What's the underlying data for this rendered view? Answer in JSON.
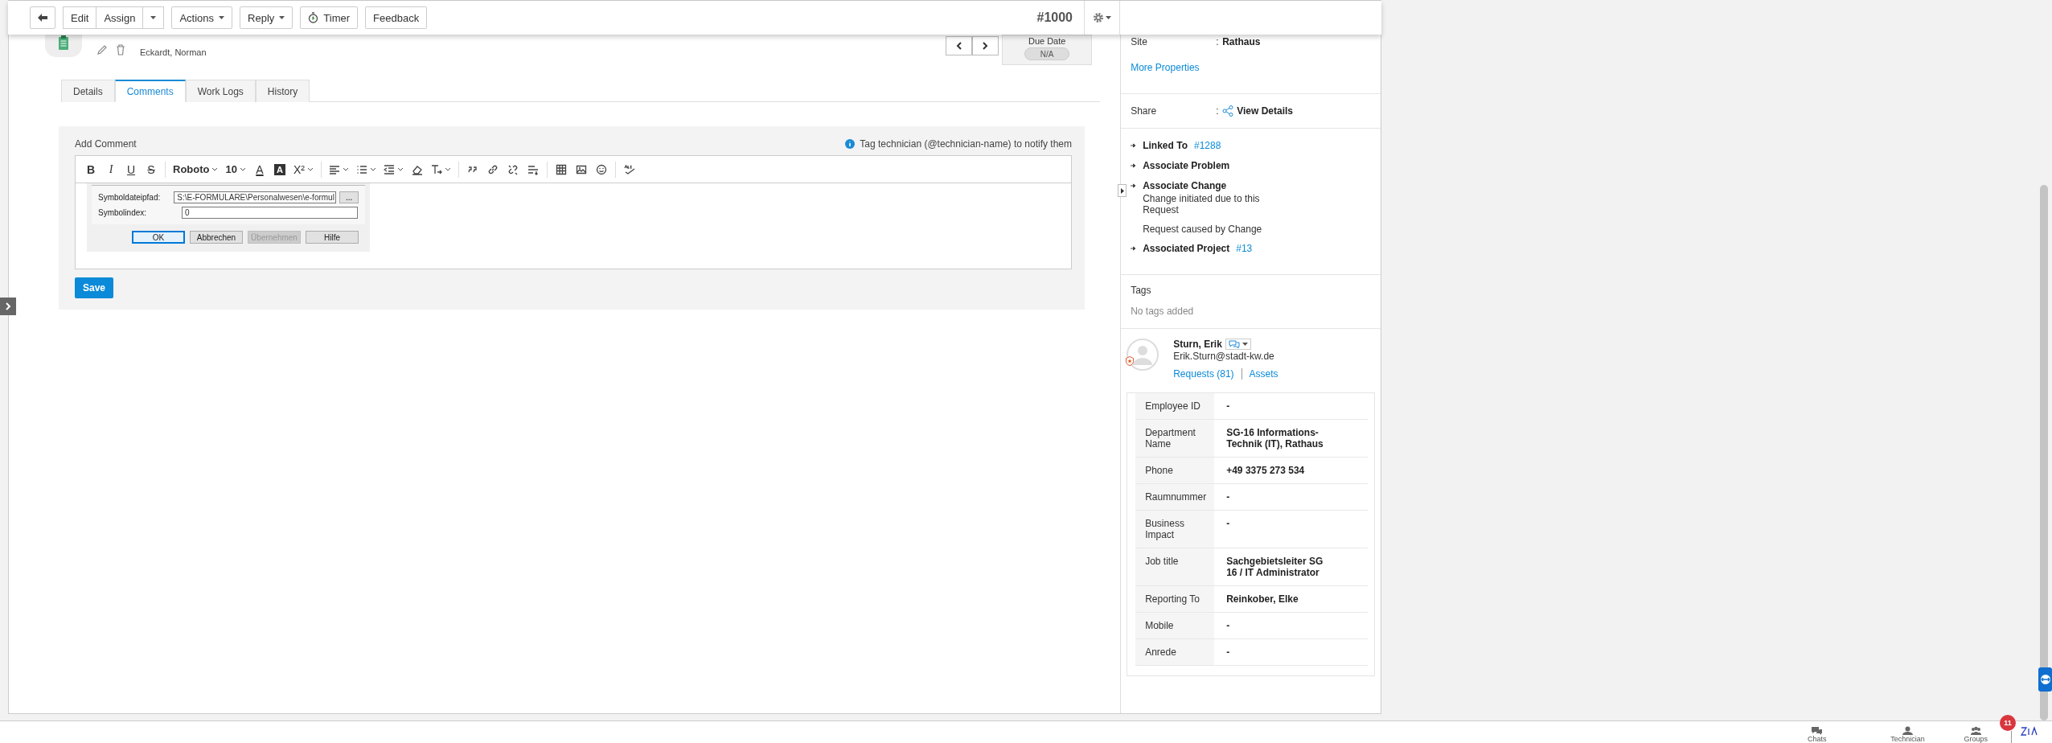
{
  "toolbar": {
    "edit": "Edit",
    "assign": "Assign",
    "actions": "Actions",
    "reply": "Reply",
    "timer": "Timer",
    "feedback": "Feedback",
    "request_id": "#1000"
  },
  "header": {
    "requester": "Eckardt, Norman",
    "due_date_label": "Due Date",
    "due_date": "N/A"
  },
  "tabs": [
    {
      "label": "Details",
      "selected": false
    },
    {
      "label": "Comments",
      "selected": true
    },
    {
      "label": "Work Logs",
      "selected": false
    },
    {
      "label": "History",
      "selected": false
    }
  ],
  "comment": {
    "title": "Add Comment",
    "hint": "Tag technician (@technician-name) to notify them",
    "editor": {
      "format_buttons": [
        {
          "label": "B",
          "kind": "bold"
        },
        {
          "label": "I",
          "kind": "italic"
        },
        {
          "label": "U",
          "kind": "underline"
        },
        {
          "label": "S",
          "kind": "strike"
        }
      ],
      "font": "Roboto",
      "size": "10",
      "color_buttons": [
        {
          "label": "A",
          "kind": "text-color"
        },
        {
          "label": "A",
          "kind": "highlight"
        }
      ],
      "superscript": "X²"
    },
    "pasted_dialog": {
      "fields": [
        {
          "label": "Symboldateipfad:",
          "value": "S:\\E-FORMULARE\\Personalwesen\\e-formul",
          "browse": "..."
        },
        {
          "label": "Symbolindex:",
          "value": "0"
        }
      ],
      "buttons": [
        {
          "label": "OK",
          "focused": true,
          "disabled": false
        },
        {
          "label": "Abbrechen",
          "focused": false,
          "disabled": false
        },
        {
          "label": "Übernehmen",
          "focused": false,
          "disabled": true
        },
        {
          "label": "Hilfe",
          "focused": false,
          "disabled": false
        }
      ]
    },
    "save": "Save"
  },
  "right_panel": {
    "properties": [
      {
        "label": "Site",
        "separator": ":",
        "value": "Rathaus"
      }
    ],
    "more_link": "More Properties",
    "share": {
      "label": "Share",
      "separator": ":",
      "value": "View Details"
    },
    "associations": [
      {
        "label": "Linked To",
        "link": "#1288"
      },
      {
        "label": "Associate Problem"
      },
      {
        "label": "Associate Change",
        "notes": [
          "Change initiated due to this Request",
          "Request caused by Change"
        ]
      },
      {
        "label": "Associated Project",
        "link": "#13"
      }
    ],
    "tags": {
      "title": "Tags",
      "empty": "No tags added"
    },
    "requester": {
      "name": "Sturn, Erik",
      "email": "Erik.Sturn@stadt-kw.de",
      "links": [
        "Requests (81)",
        "Assets"
      ],
      "details": [
        {
          "label": "Employee ID",
          "value": "-"
        },
        {
          "label": "Department Name",
          "value": "SG-16 Informations-Technik (IT), Rathaus"
        },
        {
          "label": "Phone",
          "value": "+49 3375 273 534"
        },
        {
          "label": "Raumnummer",
          "value": "-"
        },
        {
          "label": "Business Impact",
          "value": "-"
        },
        {
          "label": "Job title",
          "value": "Sachgebietsleiter SG 16 / IT Administrator"
        },
        {
          "label": "Reporting To",
          "value": "Reinkober, Elke"
        },
        {
          "label": "Mobile",
          "value": "-"
        },
        {
          "label": "Anrede",
          "value": "-"
        }
      ]
    }
  },
  "bottom_bar": {
    "items": [
      "Chats",
      "Technician",
      "Groups"
    ],
    "badge": "11"
  }
}
